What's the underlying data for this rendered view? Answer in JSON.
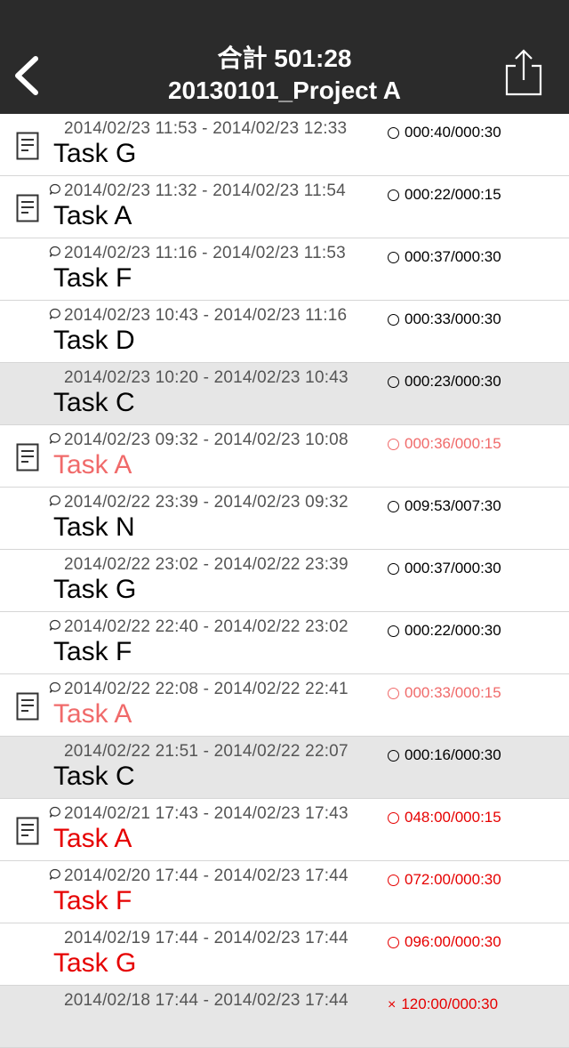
{
  "header": {
    "total": "合計 501:28",
    "project": "20130101_Project A"
  },
  "colors": {
    "overdue_light": "#f06a6a",
    "overdue": "#e60000",
    "navbar": "#2b2b2b"
  },
  "entries": [
    {
      "range": "2014/02/23 11:53 - 2014/02/23 12:33",
      "task": "Task G",
      "time": "000:40/000:30",
      "doc": true,
      "comment": false,
      "style": "normal",
      "bg": "white",
      "mark": "circle"
    },
    {
      "range": "2014/02/23 11:32 - 2014/02/23 11:54",
      "task": "Task A",
      "time": "000:22/000:15",
      "doc": true,
      "comment": true,
      "style": "normal",
      "bg": "white",
      "mark": "circle"
    },
    {
      "range": "2014/02/23 11:16 - 2014/02/23 11:53",
      "task": "Task F",
      "time": "000:37/000:30",
      "doc": false,
      "comment": true,
      "style": "normal",
      "bg": "white",
      "mark": "circle"
    },
    {
      "range": "2014/02/23 10:43 - 2014/02/23 11:16",
      "task": "Task D",
      "time": "000:33/000:30",
      "doc": false,
      "comment": true,
      "style": "normal",
      "bg": "white",
      "mark": "circle"
    },
    {
      "range": "2014/02/23 10:20 - 2014/02/23 10:43",
      "task": "Task C",
      "time": "000:23/000:30",
      "doc": false,
      "comment": false,
      "style": "normal",
      "bg": "gray",
      "mark": "circle"
    },
    {
      "range": "2014/02/23 09:32 - 2014/02/23 10:08",
      "task": "Task A",
      "time": "000:36/000:15",
      "doc": true,
      "comment": true,
      "style": "pink",
      "bg": "white",
      "mark": "circle"
    },
    {
      "range": "2014/02/22 23:39 - 2014/02/23 09:32",
      "task": "Task N",
      "time": "009:53/007:30",
      "doc": false,
      "comment": true,
      "style": "normal",
      "bg": "white",
      "mark": "circle"
    },
    {
      "range": "2014/02/22 23:02 - 2014/02/22 23:39",
      "task": "Task G",
      "time": "000:37/000:30",
      "doc": false,
      "comment": false,
      "style": "normal",
      "bg": "white",
      "mark": "circle"
    },
    {
      "range": "2014/02/22 22:40 - 2014/02/22 23:02",
      "task": "Task F",
      "time": "000:22/000:30",
      "doc": false,
      "comment": true,
      "style": "normal",
      "bg": "white",
      "mark": "circle"
    },
    {
      "range": "2014/02/22 22:08 - 2014/02/22 22:41",
      "task": "Task A",
      "time": "000:33/000:15",
      "doc": true,
      "comment": true,
      "style": "pink",
      "bg": "white",
      "mark": "circle"
    },
    {
      "range": "2014/02/22 21:51 - 2014/02/22 22:07",
      "task": "Task C",
      "time": "000:16/000:30",
      "doc": false,
      "comment": false,
      "style": "normal",
      "bg": "gray",
      "mark": "circle"
    },
    {
      "range": "2014/02/21 17:43 - 2014/02/23 17:43",
      "task": "Task A",
      "time": "048:00/000:15",
      "doc": true,
      "comment": true,
      "style": "red",
      "bg": "white",
      "mark": "circle"
    },
    {
      "range": "2014/02/20 17:44 - 2014/02/23 17:44",
      "task": "Task F",
      "time": "072:00/000:30",
      "doc": false,
      "comment": true,
      "style": "red",
      "bg": "white",
      "mark": "circle"
    },
    {
      "range": "2014/02/19 17:44 - 2014/02/23 17:44",
      "task": "Task G",
      "time": "096:00/000:30",
      "doc": false,
      "comment": false,
      "style": "red",
      "bg": "white",
      "mark": "circle"
    },
    {
      "range": "2014/02/18 17:44 - 2014/02/23 17:44",
      "task": "",
      "time": "120:00/000:30",
      "doc": false,
      "comment": false,
      "style": "red",
      "bg": "gray",
      "mark": "cross"
    }
  ],
  "icons": {
    "back": "chevron-left-icon",
    "share": "share-icon",
    "doc": "document-icon",
    "comment": "comment-icon"
  }
}
